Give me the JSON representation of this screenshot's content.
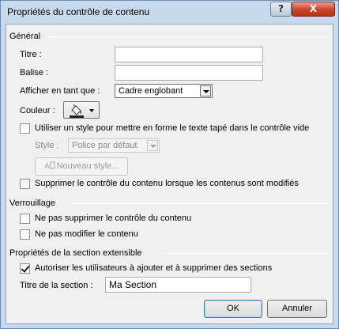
{
  "window": {
    "title": "Propriétés du contrôle de contenu",
    "help_glyph": "?",
    "close_glyph": "X"
  },
  "general": {
    "section_title": "Général",
    "title_label": "Titre :",
    "title_value": "",
    "tag_label": "Balise :",
    "tag_value": "",
    "show_as_label": "Afficher en tant que :",
    "show_as_value": "Cadre englobant",
    "color_label": "Couleur :",
    "use_style_label": "Utiliser un style pour mettre en forme le texte tapé dans le contrôle vide",
    "use_style_checked": false,
    "style_label": "Style :",
    "style_value": "Police par défaut",
    "new_style_button": "Nouveau style...",
    "remove_control_label": "Supprimer le contrôle du contenu lorsque les contenus sont modifiés",
    "remove_control_checked": false
  },
  "locking": {
    "section_title": "Verrouillage",
    "cannot_delete_label": "Ne pas supprimer le contrôle du contenu",
    "cannot_delete_checked": false,
    "cannot_edit_label": "Ne pas modifier le contenu",
    "cannot_edit_checked": false
  },
  "repeating": {
    "section_title": "Propriétés de la section extensible",
    "allow_label": "Autoriser les utilisateurs à ajouter et à supprimer des sections",
    "allow_checked": true,
    "section_title_label": "Titre de la section :",
    "section_title_value": "Ma Section"
  },
  "footer": {
    "ok_label": "OK",
    "cancel_label": "Annuler"
  },
  "icons": {
    "paint_bucket": "paint-bucket-icon",
    "new_style": "new-style-icon"
  }
}
